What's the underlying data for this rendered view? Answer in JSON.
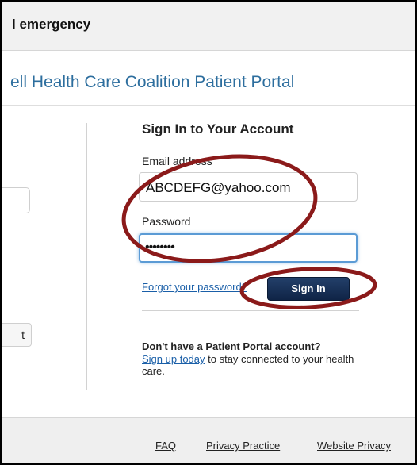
{
  "banner": {
    "text": "l emergency"
  },
  "portal": {
    "title": "ell Health Care Coalition Patient Portal"
  },
  "left_panel": {
    "button_label": "t"
  },
  "signin": {
    "heading": "Sign In to Your Account",
    "email_label": "Email address",
    "email_value": "ABCDEFG@yahoo.com",
    "password_label": "Password",
    "password_value": "••••••••",
    "forgot_link": "Forgot your password?",
    "button_label": "Sign In"
  },
  "signup": {
    "heading": "Don't have a Patient Portal account?",
    "link": "Sign up today",
    "text": " to stay connected to your health care."
  },
  "footer": {
    "links": [
      "FAQ",
      "Privacy Practice",
      "Website Privacy"
    ]
  },
  "colors": {
    "title_blue": "#2d6e9e",
    "link_blue": "#1a5fa8",
    "button_navy": "#0f2446",
    "annotation_red": "#8b1a1a",
    "focus_blue": "#5b9bd5"
  }
}
